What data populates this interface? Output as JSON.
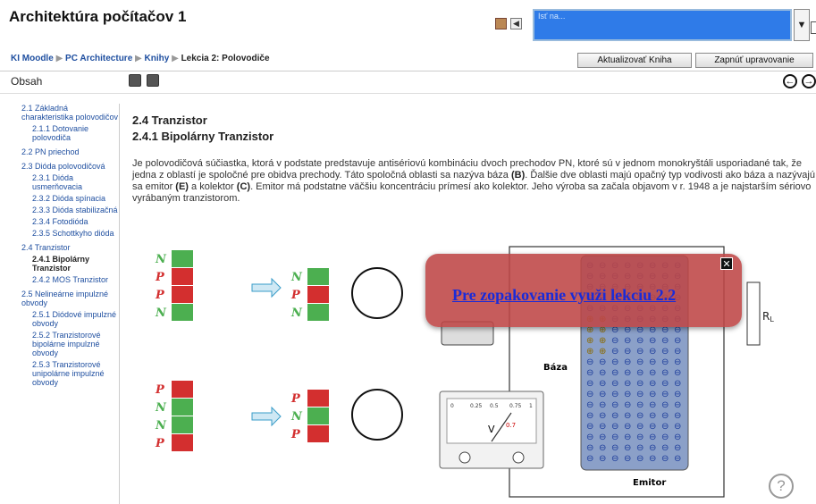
{
  "header": {
    "title": "Architektúra počítačov 1",
    "search_value": "Isť na...",
    "dropdown_arrow": "▼"
  },
  "breadcrumb": {
    "items": [
      "KI Moodle",
      "PC Architecture",
      "Knihy"
    ],
    "current": "Lekcia 2: Polovodiče",
    "separator": "▶"
  },
  "buttons": {
    "update_book": "Aktualizovať Kniha",
    "edit_mode": "Zapnúť upravovanie"
  },
  "toc_label": "Obsah",
  "toc": [
    {
      "label": "2.1 Základná charakteristika polovodičov",
      "level": 1
    },
    {
      "label": "2.1.1 Dotovanie polovodiča",
      "level": 2
    },
    {
      "label": "2.2 PN priechod",
      "level": 1
    },
    {
      "label": "2.3 Dióda polovodičová",
      "level": 1
    },
    {
      "label": "2.3.1 Dióda usmerňovacia",
      "level": 2
    },
    {
      "label": "2.3.2 Dióda spínacia",
      "level": 2
    },
    {
      "label": "2.3.3 Dióda stabilizačná",
      "level": 2
    },
    {
      "label": "2.3.4 Fotodióda",
      "level": 2
    },
    {
      "label": "2.3.5 Schottkyho dióda",
      "level": 2
    },
    {
      "label": "2.4 Tranzistor",
      "level": 1
    },
    {
      "label": "2.4.1 Bipolárny Tranzistor",
      "level": 2,
      "active": true
    },
    {
      "label": "2.4.2 MOS Tranzistor",
      "level": 2
    },
    {
      "label": "2.5 Nelineárne impulzné obvody",
      "level": 1
    },
    {
      "label": "2.5.1 Diódové impulzné obvody",
      "level": 2
    },
    {
      "label": "2.5.2 Tranzistorové bipolárne impulzné obvody",
      "level": 2
    },
    {
      "label": "2.5.3 Tranzistorové unipolárne impulzné obvody",
      "level": 2
    }
  ],
  "content": {
    "heading1": "2.4 Tranzistor",
    "heading2": "2.4.1 Bipolárny Tranzistor",
    "paragraph": [
      {
        "t": "Je polovodičová súčiastka, ktorá v podstate predstavuje antisériovú kombináciu dvoch prechodov PN, ktoré sú v jednom monokryštáli usporiadané tak, že jedna z oblastí je spoločné pre obidva prechody. Táto spoločná oblasti sa nazýva báza "
      },
      {
        "b": "(B)"
      },
      {
        "t": ". Ďalšie dve oblasti majú opačný typ vodivosti ako báza a nazývajú sa emitor "
      },
      {
        "b": "(E)"
      },
      {
        "t": " a kolektor "
      },
      {
        "b": "(C)"
      },
      {
        "t": ". Emitor má podstatne väčšiu koncentráciu prímesí ako kolektor. Jeho výroba sa začala objavom v r. 1948 a je najstarším sériovo vyrábaným tranzistorom."
      }
    ]
  },
  "figure": {
    "letters_top": [
      "N",
      "P",
      "P",
      "N"
    ],
    "letters_top_mid": [
      "N",
      "P",
      "N"
    ],
    "letters_bottom": [
      "P",
      "N",
      "N",
      "P"
    ],
    "letters_bottom_mid": [
      "P",
      "N",
      "P"
    ],
    "baza_label": "Báza",
    "emitor_label": "Emitor",
    "rl_label": "R",
    "rl_sub": "L",
    "meter_ticks": [
      "0",
      "0.25",
      "0.5",
      "0.75",
      "1"
    ],
    "meter_unit": "V",
    "meter_value": "0.7",
    "electron_symbol": "⊖",
    "hole_symbol": "⊕"
  },
  "popup": {
    "link_text": "Pre zopakovanie využi lekciu 2.2",
    "close_icon": "✕"
  },
  "help_icon": "?",
  "nav": {
    "prev": "◀",
    "next": "▶",
    "back": "←",
    "fwd": "→"
  },
  "colors": {
    "link": "#1f4fa0",
    "search_bg": "#2f7be8",
    "popup_bg": "#be4646",
    "n_region": "#4caf50",
    "p_region": "#d32f2f"
  }
}
